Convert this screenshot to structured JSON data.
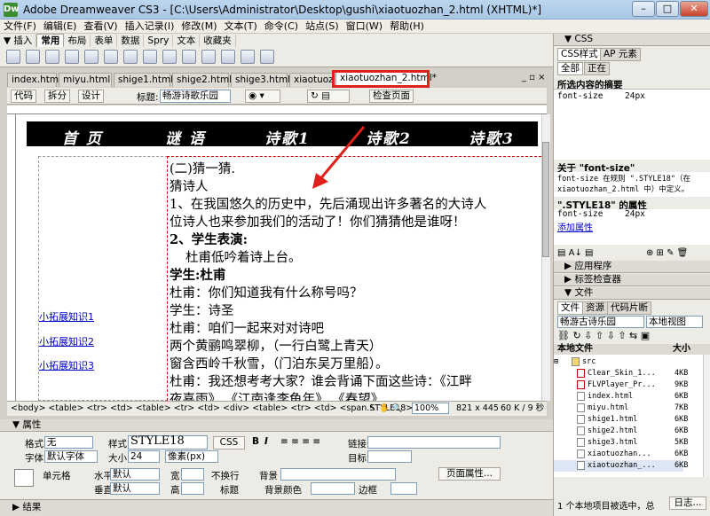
{
  "window": {
    "title": "Adobe Dreamweaver CS3 - [C:\\Users\\Administrator\\Desktop\\gushi\\xiaotuozhan_2.html (XHTML)*]",
    "app_icon": "Dw"
  },
  "menu": [
    "文件(F)",
    "编辑(E)",
    "查看(V)",
    "插入记录(I)",
    "修改(M)",
    "文本(T)",
    "命令(C)",
    "站点(S)",
    "窗口(W)",
    "帮助(H)"
  ],
  "insert_bar": {
    "tabs": [
      "▼ 插入",
      "常用",
      "布局",
      "表单",
      "数据",
      "Spry",
      "文本",
      "收藏夹"
    ]
  },
  "doc_tabs": [
    "index.html",
    "miyu.html",
    "shige1.html",
    "shige2.html",
    "shige3.html",
    "xiaotuozhan.html",
    "xiaotuozhan_2.html*"
  ],
  "doc_toolbar": {
    "code": "代码",
    "split": "拆分",
    "design": "设计",
    "title_label": "标题:",
    "title_value": "畅游诗歌乐园",
    "check_page": "检查页面"
  },
  "page": {
    "nav": [
      "首 页",
      "谜 语",
      "诗歌1",
      "诗歌2",
      "诗歌3"
    ],
    "side_links": [
      "小拓展知识1",
      "小拓展知识2",
      "小拓展知识3"
    ],
    "lines": [
      "(二)猜一猜.",
      "猜诗人",
      "1、在我国悠久的历史中，先后涌现出许多著名的大诗人",
      "位诗人也来参加我们的活动了！你们猜猜他是谁呀！",
      "2、学生表演:",
      "杜甫低吟着诗上台。",
      "学生:杜甫",
      "杜甫：你们知道我有什么称号吗？",
      "学生：诗圣",
      "杜甫：咱们一起来对对诗吧",
      "两个黄鹂鸣翠柳，（一行白鹭上青天）",
      "窗含西岭千秋雪，（门泊东吴万里船）。",
      "杜甫：我还想考考大家？谁会背诵下面这些诗：《江畔",
      "夜喜雨》 《江南逢李龟年》 《春望》"
    ]
  },
  "status_bar": {
    "path": "<body> <table> <tr> <td> <table> <tr> <td> <div> <table> <tr> <td> <span.STYLE18>",
    "zoom": "100%",
    "size": "821 x 445",
    "filesize": "60 K / 9 秒"
  },
  "properties": {
    "header": "▼ 属性",
    "format_label": "格式",
    "format_value": "无",
    "style_label": "样式",
    "style_value": "STYLE18",
    "css_btn": "CSS",
    "font_label": "字体",
    "font_value": "默认字体",
    "size_label": "大小",
    "size_value": "24",
    "unit_value": "像素(px)",
    "link_label": "链接",
    "target_label": "目标",
    "cell_label": "单元格",
    "horiz_label": "水平",
    "horiz_value": "默认",
    "vert_label": "垂直",
    "vert_value": "默认",
    "width_label": "宽",
    "height_label": "高",
    "nowrap_label": "不换行",
    "header_label": "标题",
    "bg_label": "背景",
    "bgcolor_label": "背景颜色",
    "border_label": "边框",
    "page_props": "页面属性..."
  },
  "results_header": "▶ 结果",
  "right_panel": {
    "css_header": "▼ CSS",
    "css_tabs": [
      "CSS样式",
      "AP 元素"
    ],
    "mode_tabs": [
      "全部",
      "正在"
    ],
    "summary_title": "所选内容的摘要",
    "summary_prop": "font-size",
    "summary_val": "24px",
    "about_title": "关于 \"font-size\"",
    "about_text_1": "font-size 在规则 \".STYLE18\"（在",
    "about_text_2": "xiaotuozhan_2.html 中）中定义。",
    "rule_title": "\".STYLE18\" 的属性",
    "rule_prop": "font-size",
    "rule_val": "24px",
    "add_prop": "添加属性",
    "app_header": "▶ 应用程序",
    "tag_header": "▶ 标签检查器",
    "files_header": "▼ 文件",
    "files_tabs": [
      "文件",
      "资源",
      "代码片断"
    ],
    "site_value": "畅游古诗乐园",
    "view_value": "本地视图",
    "col_name": "本地文件",
    "col_size": "大小",
    "files": [
      {
        "name": "src",
        "size": ""
      },
      {
        "name": "Clear_Skin_1...",
        "size": "4KB"
      },
      {
        "name": "FLVPlayer_Pr...",
        "size": "9KB"
      },
      {
        "name": "index.html",
        "size": "6KB"
      },
      {
        "name": "miyu.html",
        "size": "7KB"
      },
      {
        "name": "shige1.html",
        "size": "6KB"
      },
      {
        "name": "shige2.html",
        "size": "6KB"
      },
      {
        "name": "shige3.html",
        "size": "5KB"
      },
      {
        "name": "xiaotuozhan...",
        "size": "6KB"
      },
      {
        "name": "xiaotuozhan_...",
        "size": "6KB"
      }
    ],
    "files_status": "1 个本地项目被选中，总",
    "log_btn": "日志..."
  },
  "colors": {
    "highlight_red": "#e0201b",
    "nav_bg": "#000000",
    "link_blue": "#0000cc"
  }
}
